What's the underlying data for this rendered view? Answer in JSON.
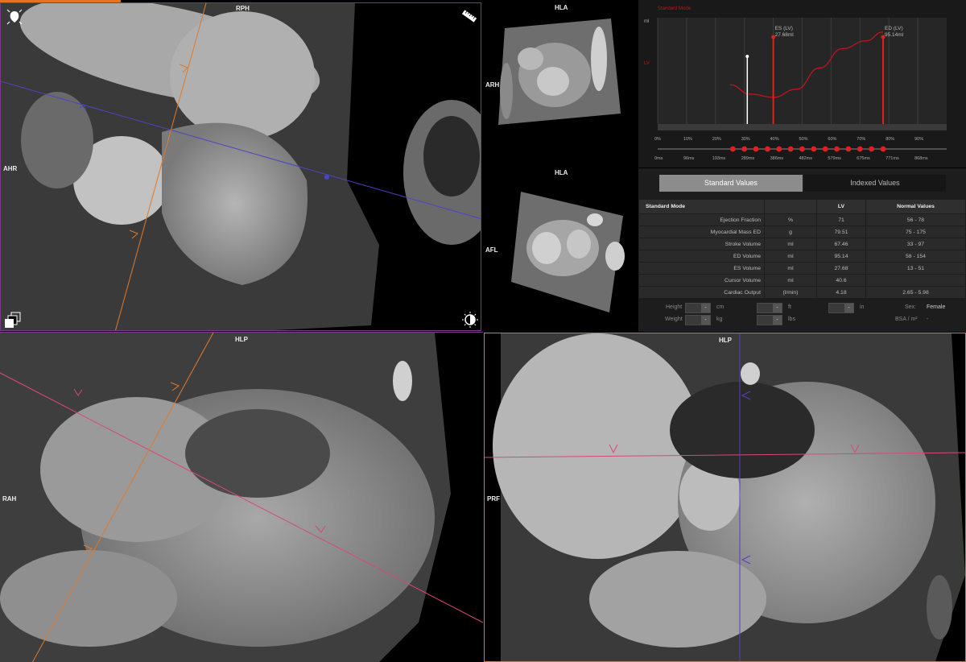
{
  "viewports": {
    "top_left": {
      "labels": {
        "top": "RPH",
        "left": "AHR"
      }
    },
    "hla_top": {
      "labels": {
        "top": "HLA",
        "left": "ARH"
      }
    },
    "hla_bottom": {
      "labels": {
        "top": "HLA",
        "left": "AFL"
      }
    },
    "bottom_left": {
      "labels": {
        "top": "HLP",
        "left": "RAH"
      }
    },
    "bottom_right": {
      "labels": {
        "top": "HLP",
        "left": "PRF"
      }
    }
  },
  "icons": {
    "top_left_corner": "heart-view-icon",
    "ruler": "ruler-icon",
    "layers": "layers-icon",
    "contrast": "contrast-icon"
  },
  "chart_data": {
    "type": "line",
    "title": "Standard Mode",
    "ylabel_unit": "ml",
    "series_label": "LV",
    "x_percent_ticks": [
      "0%",
      "10%",
      "20%",
      "30%",
      "40%",
      "50%",
      "60%",
      "70%",
      "80%",
      "90%"
    ],
    "x_ms_ticks": [
      "0ms",
      "96ms",
      "193ms",
      "289ms",
      "386ms",
      "482ms",
      "579ms",
      "675ms",
      "771ms",
      "868ms"
    ],
    "series": [
      {
        "name": "LV",
        "x_percent": [
          25,
          32,
          40,
          48,
          56,
          64,
          72,
          78
        ],
        "values": [
          40.6,
          31,
          27.68,
          36,
          58,
          78,
          86,
          95.14
        ]
      }
    ],
    "markers": [
      {
        "label": "ES (LV)",
        "value": "27.68ml",
        "x_percent": 40
      },
      {
        "label": "ED (LV)",
        "value": "95.14ml",
        "x_percent": 78
      }
    ],
    "cursor_x_percent": 31,
    "phase_points_percent": [
      26,
      30,
      34,
      38,
      42,
      46,
      50,
      54,
      58,
      62,
      66,
      70,
      74,
      78
    ],
    "colors": {
      "curve": "#c0141d",
      "marker": "#e02020",
      "cursor": "#ffffff",
      "title": "#c0141d"
    }
  },
  "tabs": {
    "standard": "Standard Values",
    "indexed": "Indexed Values"
  },
  "table": {
    "headers": [
      "Standard Mode",
      "",
      "LV",
      "Normal Values"
    ],
    "rows": [
      {
        "label": "Ejection Fraction",
        "unit": "%",
        "lv": "71",
        "normal": "56 - 78"
      },
      {
        "label": "Myocardial Mass ED",
        "unit": "g",
        "lv": "79.51",
        "normal": "75 - 175"
      },
      {
        "label": "Stroke Volume",
        "unit": "ml",
        "lv": "67.46",
        "normal": "33 - 97"
      },
      {
        "label": "ED Volume",
        "unit": "ml",
        "lv": "95.14",
        "normal": "58 - 154"
      },
      {
        "label": "ES Volume",
        "unit": "ml",
        "lv": "27.68",
        "normal": "13 - 51"
      },
      {
        "label": "Cursor Volume",
        "unit": "ml",
        "lv": "40.6",
        "normal": ""
      },
      {
        "label": "Cardiac Output",
        "unit": "(l/min)",
        "lv": "4.18",
        "normal": "2.65 - 5.98"
      }
    ]
  },
  "patient": {
    "height_label": "Height",
    "height_unit_cm": "cm",
    "height_unit_ft": "ft",
    "height_unit_in": "in",
    "weight_label": "Weight",
    "weight_unit_kg": "kg",
    "weight_unit_lbs": "lbs",
    "sex_label": "Sex:",
    "sex_value": "Female",
    "bsa_label": "BSA / m²",
    "bsa_value": "-",
    "minus": "-"
  },
  "colors": {
    "accent_orange": "#e6731e",
    "viewport_border_purple": "#7a3a8a",
    "tab_active": "#8c8c8c"
  }
}
